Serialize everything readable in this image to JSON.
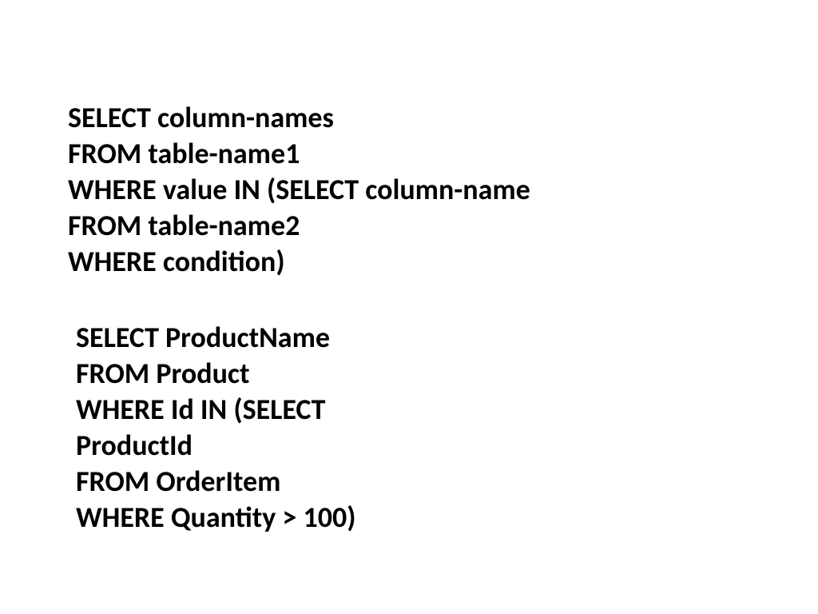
{
  "block1": {
    "line1": "SELECT column-names",
    "line2": "FROM table-name1",
    "line3": "WHERE value IN (SELECT column-name",
    "line4": "FROM table-name2",
    "line5": "WHERE condition)"
  },
  "block2": {
    "line1": "SELECT ProductName",
    "line2": "FROM Product",
    "line3": "WHERE Id IN (SELECT",
    "line4": "ProductId",
    "line5": "FROM OrderItem",
    "line6": "WHERE Quantity > 100)"
  }
}
